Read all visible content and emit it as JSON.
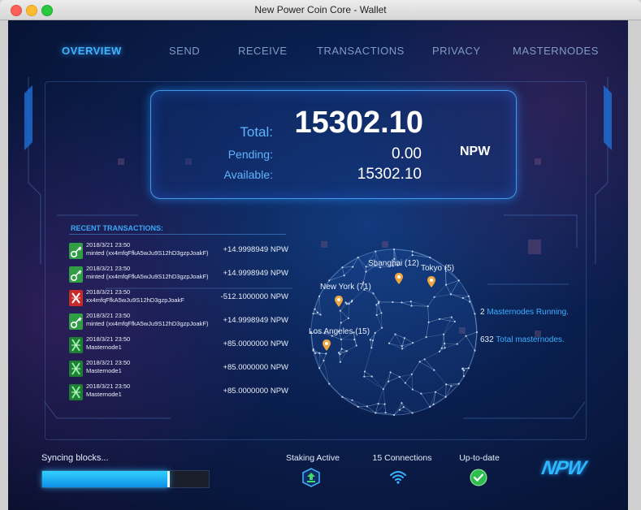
{
  "window": {
    "title": "New Power  Coin Core - Wallet"
  },
  "nav": [
    {
      "label": "OVERVIEW",
      "active": true
    },
    {
      "label": "SEND"
    },
    {
      "label": "RECEIVE"
    },
    {
      "label": "TRANSACTIONS"
    },
    {
      "label": "PRIVACY"
    },
    {
      "label": "MASTERNODES"
    }
  ],
  "balance": {
    "total_label": "Total:",
    "total": "15302.10",
    "pending_label": "Pending:",
    "pending": "0.00",
    "available_label": "Available:",
    "available": "15302.10",
    "unit": "NPW"
  },
  "recent": {
    "title": "RECENT TRANSACTIONS:",
    "items": [
      {
        "date": "2018/3/21 23:50",
        "desc": "minted (xx4mfqFfkA5wJu9S12hD3gzpJoakF)",
        "amount": "+14.9998949 NPW",
        "type": "minted"
      },
      {
        "date": "2018/3/21 23:50",
        "desc": "minted (xx4mfqFfkA5wJu9S12hD3gzpJoakF)",
        "amount": "+14.9998949 NPW",
        "type": "minted"
      },
      {
        "date": "2018/3/21 23:50",
        "desc": "xx4mfqFfkA5wJu9S12hD3gzpJoakF",
        "amount": "-512.1000000 NPW",
        "type": "sent"
      },
      {
        "date": "2018/3/21 23:50",
        "desc": "minted (xx4mfqFfkA5wJu9S12hD3gzpJoakF)",
        "amount": "+14.9998949 NPW",
        "type": "minted"
      },
      {
        "date": "2018/3/21 23:50",
        "desc": "Masternode1",
        "amount": "+85.0000000 NPW",
        "type": "masternode"
      },
      {
        "date": "2018/3/21 23:50",
        "desc": "Masternode1",
        "amount": "+85.0000000 NPW",
        "type": "masternode"
      },
      {
        "date": "2018/3/21 23:50",
        "desc": "Masternode1",
        "amount": "+85.0000000 NPW",
        "type": "masternode"
      }
    ]
  },
  "cities": [
    {
      "label": "Shanghai (12)"
    },
    {
      "label": "Tokyo (5)"
    },
    {
      "label": "New York (71)"
    },
    {
      "label": "Los Angeles (15)"
    }
  ],
  "masternodes": {
    "running_count": "2",
    "running_label": "Masternodes Running.",
    "total_count": "632",
    "total_label": "Total masternodes."
  },
  "status": {
    "sync_label": "Syncing blocks...",
    "sync_progress": 0.76,
    "staking_label": "Staking Active",
    "connections_label": "15 Connections",
    "uptodate_label": "Up-to-date"
  },
  "logo": "NPW",
  "colors": {
    "accent": "#3fb4ff",
    "minted": "#3cc85a",
    "sent": "#d8322f",
    "masternode": "#2fb34a"
  },
  "icons": {
    "minted": "key-icon",
    "sent": "cross-icon",
    "masternode": "masternode-x-icon",
    "staking": "staking-upload-icon",
    "connections": "wifi-icon",
    "uptodate": "check-circle-icon"
  }
}
